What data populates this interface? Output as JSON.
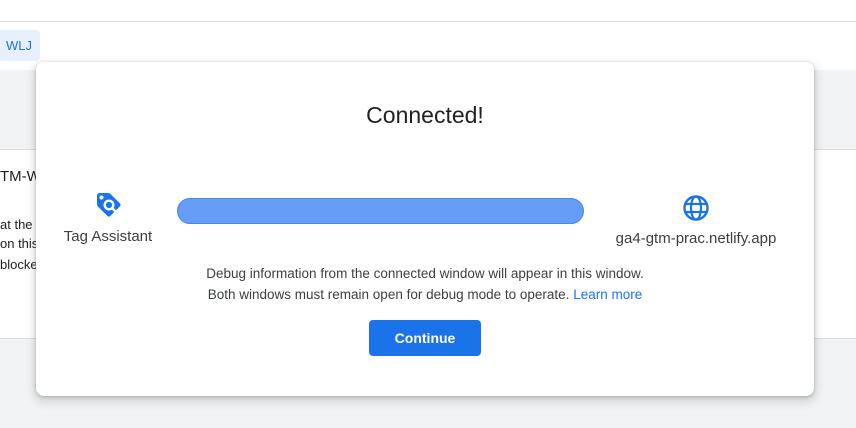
{
  "background": {
    "chip_label": "WLJ",
    "section_title": "TM-W",
    "lines": [
      "at the f",
      "on this",
      "blocke"
    ]
  },
  "dialog": {
    "title": "Connected!",
    "left_endpoint": {
      "label": "Tag Assistant",
      "icon": "tag-assistant-icon"
    },
    "right_endpoint": {
      "label": "ga4-gtm-prac.netlify.app",
      "icon": "globe-icon"
    },
    "progress_fraction": 1.0,
    "description_line1": "Debug information from the connected window will appear in this window.",
    "description_line2": "Both windows must remain open for debug mode to operate.",
    "learn_more": "Learn more",
    "continue_label": "Continue"
  },
  "colors": {
    "accent": "#1a73e8",
    "progress_fill": "#669df6"
  }
}
